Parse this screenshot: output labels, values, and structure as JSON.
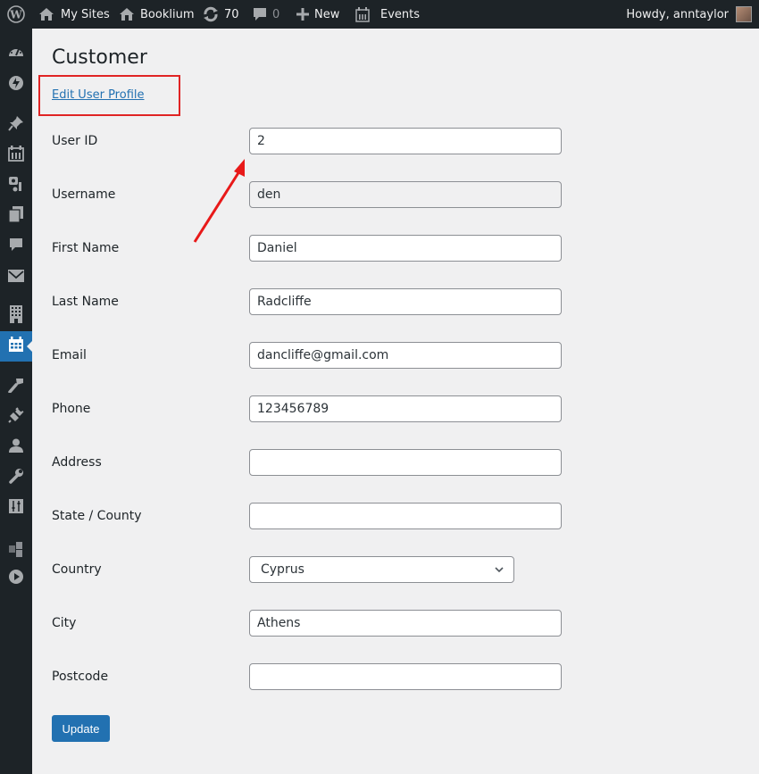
{
  "adminbar": {
    "my_sites": "My Sites",
    "site_name": "Booklium",
    "updates_count": "70",
    "comments_count": "0",
    "new_label": "New",
    "events_label": "Events",
    "greeting": "Howdy, anntaylor"
  },
  "sidebar": {
    "items": [
      {
        "icon": "dashboard-icon"
      },
      {
        "icon": "booking-icon"
      },
      {
        "icon": "posts-pin-icon"
      },
      {
        "icon": "calendar-icon"
      },
      {
        "icon": "media-icon"
      },
      {
        "icon": "pages-icon"
      },
      {
        "icon": "comments-icon"
      },
      {
        "icon": "mail-icon"
      },
      {
        "icon": "building-icon"
      },
      {
        "icon": "calendar-active-icon",
        "active": true
      },
      {
        "icon": "appearance-brush-icon"
      },
      {
        "icon": "plugins-icon"
      },
      {
        "icon": "users-icon"
      },
      {
        "icon": "tools-wrench-icon"
      },
      {
        "icon": "settings-sliders-icon"
      },
      {
        "icon": "blocks-icon"
      },
      {
        "icon": "play-icon"
      }
    ]
  },
  "page": {
    "title": "Customer",
    "edit_link": "Edit User Profile",
    "annotation_color": "#e02424",
    "fields": [
      {
        "label": "User ID",
        "value": "2"
      },
      {
        "label": "Username",
        "value": "den",
        "readonly": true
      },
      {
        "label": "First Name",
        "value": "Daniel"
      },
      {
        "label": "Last Name",
        "value": "Radcliffe"
      },
      {
        "label": "Email",
        "value": "dancliffe@gmail.com"
      },
      {
        "label": "Phone",
        "value": "123456789"
      },
      {
        "label": "Address",
        "value": ""
      },
      {
        "label": "State / County",
        "value": ""
      },
      {
        "label": "Country",
        "value": "Cyprus",
        "type": "select"
      },
      {
        "label": "City",
        "value": "Athens"
      },
      {
        "label": "Postcode",
        "value": ""
      }
    ],
    "update_button": "Update"
  }
}
